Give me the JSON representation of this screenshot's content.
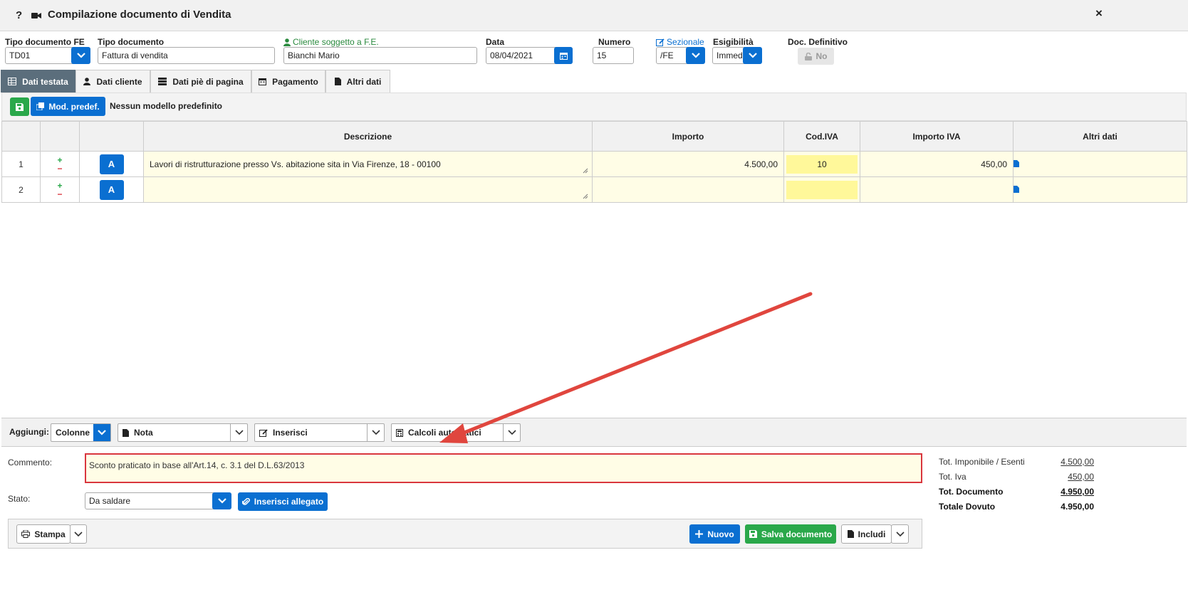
{
  "window": {
    "title": "Compilazione documento di Vendita",
    "help": "?",
    "close": "×"
  },
  "header": {
    "tipo_fe": {
      "label": "Tipo documento FE",
      "value": "TD01"
    },
    "tipo_doc": {
      "label": "Tipo documento",
      "value": "Fattura di vendita"
    },
    "cliente": {
      "label": "Cliente soggetto a F.E.",
      "value": "Bianchi Mario"
    },
    "data": {
      "label": "Data",
      "value": "08/04/2021"
    },
    "numero": {
      "label": "Numero",
      "value": "15"
    },
    "sezionale": {
      "label": "Sezionale",
      "value": "/FE"
    },
    "esigibilita": {
      "label": "Esigibilità",
      "value": "Immed"
    },
    "definitivo": {
      "label": "Doc. Definitivo",
      "value": "No"
    }
  },
  "tabs": [
    "Dati testata",
    "Dati cliente",
    "Dati piè di pagina",
    "Pagamento",
    "Altri dati"
  ],
  "toolbar": {
    "model_button": "Mod. predef.",
    "model_text": "Nessun modello predefinito"
  },
  "table": {
    "headers": [
      "Descrizione",
      "Importo",
      "Cod.IVA",
      "Importo IVA",
      "Altri dati"
    ],
    "rows": [
      {
        "n": "1",
        "a": "A",
        "descrizione": "Lavori di ristrutturazione presso Vs. abitazione sita in Via Firenze, 18 - 00100",
        "importo": "4.500,00",
        "cod_iva": "10",
        "importo_iva": "450,00"
      },
      {
        "n": "2",
        "a": "A",
        "descrizione": "",
        "importo": "",
        "cod_iva": "",
        "importo_iva": ""
      }
    ]
  },
  "addbar": {
    "label": "Aggiungi:",
    "colonne": "Colonne",
    "nota": "Nota",
    "inserisci": "Inserisci",
    "calcoli": "Calcoli automatici"
  },
  "comment": {
    "label": "Commento:",
    "value": "Sconto praticato in base all'Art.14, c. 3.1 del D.L.63/2013"
  },
  "stato": {
    "label": "Stato:",
    "value": "Da saldare",
    "allegato": "Inserisci allegato"
  },
  "totals": {
    "imponibile_label": "Tot. Imponibile / Esenti",
    "imponibile": "4.500,00",
    "iva_label": "Tot. Iva",
    "iva": "450,00",
    "documento_label": "Tot. Documento",
    "documento": "4.950,00",
    "dovuto_label": "Totale Dovuto",
    "dovuto": "4.950,00"
  },
  "bottom": {
    "stampa": "Stampa",
    "nuovo": "Nuovo",
    "salva": "Salva documento",
    "includi": "Includi"
  },
  "colors": {
    "primary": "#0a6fd1",
    "success": "#2aa84a",
    "danger": "#d9363e",
    "tab_active": "#5b6e7c",
    "annotation": "#e0463e"
  }
}
